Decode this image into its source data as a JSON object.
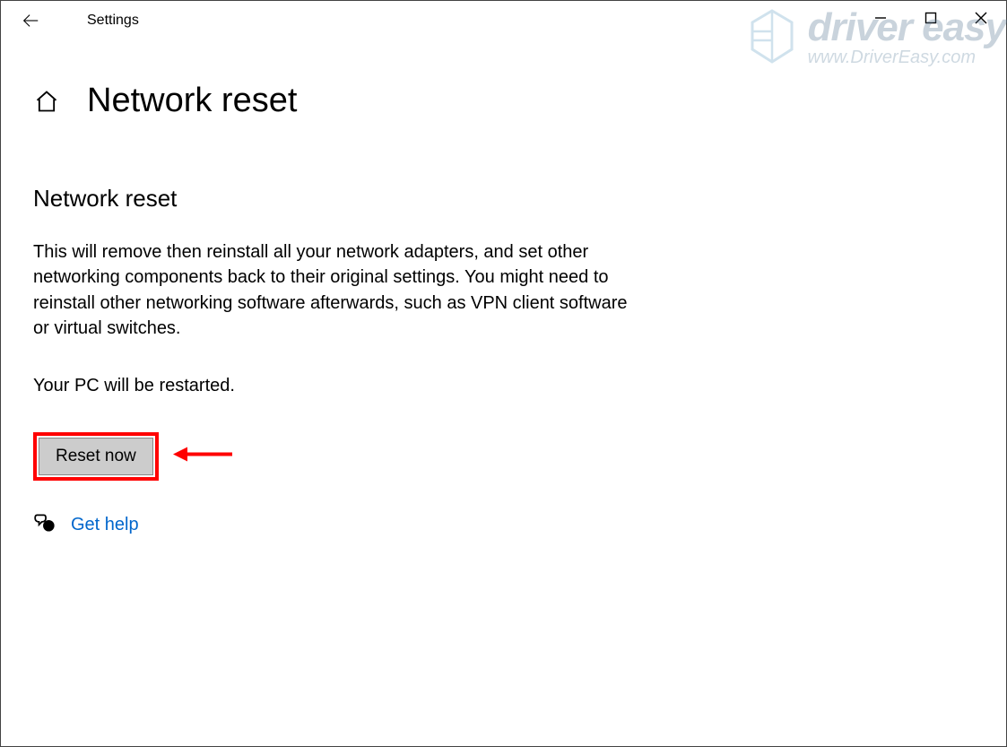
{
  "app": {
    "title": "Settings"
  },
  "page": {
    "title": "Network reset",
    "section_heading": "Network reset",
    "description": "This will remove then reinstall all your network adapters, and set other networking components back to their original settings. You might need to reinstall other networking software afterwards, such as VPN client software or virtual switches.",
    "restart_note": "Your PC will be restarted.",
    "reset_button": "Reset now",
    "help_link": "Get help"
  },
  "watermark": {
    "brand": "driver easy",
    "url": "www.DriverEasy.com"
  }
}
